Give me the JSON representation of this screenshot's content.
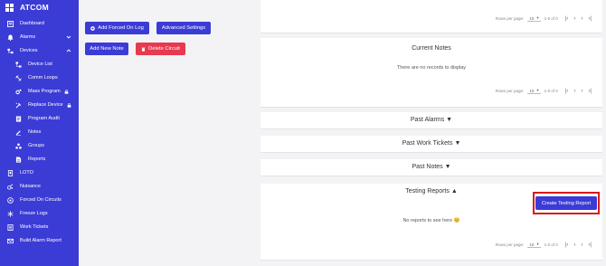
{
  "brand": {
    "name": "ATCOM"
  },
  "colors": {
    "sidebar": "#3b3bd6",
    "danger": "#e8394f",
    "highlight": "#d91a1a"
  },
  "sidebar": {
    "items": [
      {
        "label": "Dashboard",
        "icon": "dashboard-icon"
      },
      {
        "label": "Alarms",
        "icon": "alarm-icon",
        "chevron": "down"
      },
      {
        "label": "Devices",
        "icon": "devices-icon",
        "chevron": "up"
      },
      {
        "label": "Device List",
        "icon": "device-list-icon"
      },
      {
        "label": "Comm Loops",
        "icon": "comm-loop-icon"
      },
      {
        "label": "Mass Program",
        "icon": "mass-program-icon",
        "locked": true
      },
      {
        "label": "Replace Device",
        "icon": "replace-device-icon",
        "locked": true
      },
      {
        "label": "Program Audit",
        "icon": "program-audit-icon"
      },
      {
        "label": "Notes",
        "icon": "notes-icon"
      },
      {
        "label": "Groups",
        "icon": "groups-icon"
      },
      {
        "label": "Reports",
        "icon": "reports-icon"
      },
      {
        "label": "LOTO",
        "icon": "loto-icon"
      },
      {
        "label": "Nuisance",
        "icon": "nuisance-icon"
      },
      {
        "label": "Forced On Circuits",
        "icon": "forced-on-icon"
      },
      {
        "label": "Freeze Logs",
        "icon": "freeze-icon"
      },
      {
        "label": "Work Tickets",
        "icon": "work-ticket-icon"
      },
      {
        "label": "Build Alarm Report",
        "icon": "mail-icon"
      }
    ]
  },
  "actions": {
    "add_forced_on_log": "Add Forced On Log",
    "advanced_settings": "Advanced Settings",
    "add_new_note": "Add New Note",
    "delete_circuit": "Delete Circuit"
  },
  "pager": {
    "rows_per_page_label": "Rows per page:",
    "rows_per_page_value": "10",
    "range": "1-0 of 0"
  },
  "sections": {
    "current_notes": {
      "title": "Current Notes",
      "empty_msg": "There are no records to display"
    },
    "past_alarms": {
      "title": "Past Alarms ▼"
    },
    "past_work_tickets": {
      "title": "Past Work Tickets ▼"
    },
    "past_notes": {
      "title": "Past Notes ▼"
    },
    "testing_reports": {
      "title": "Testing Reports ▲",
      "empty_msg": "No reports to see here 🥺",
      "create_button": "Create Testing Report"
    }
  }
}
